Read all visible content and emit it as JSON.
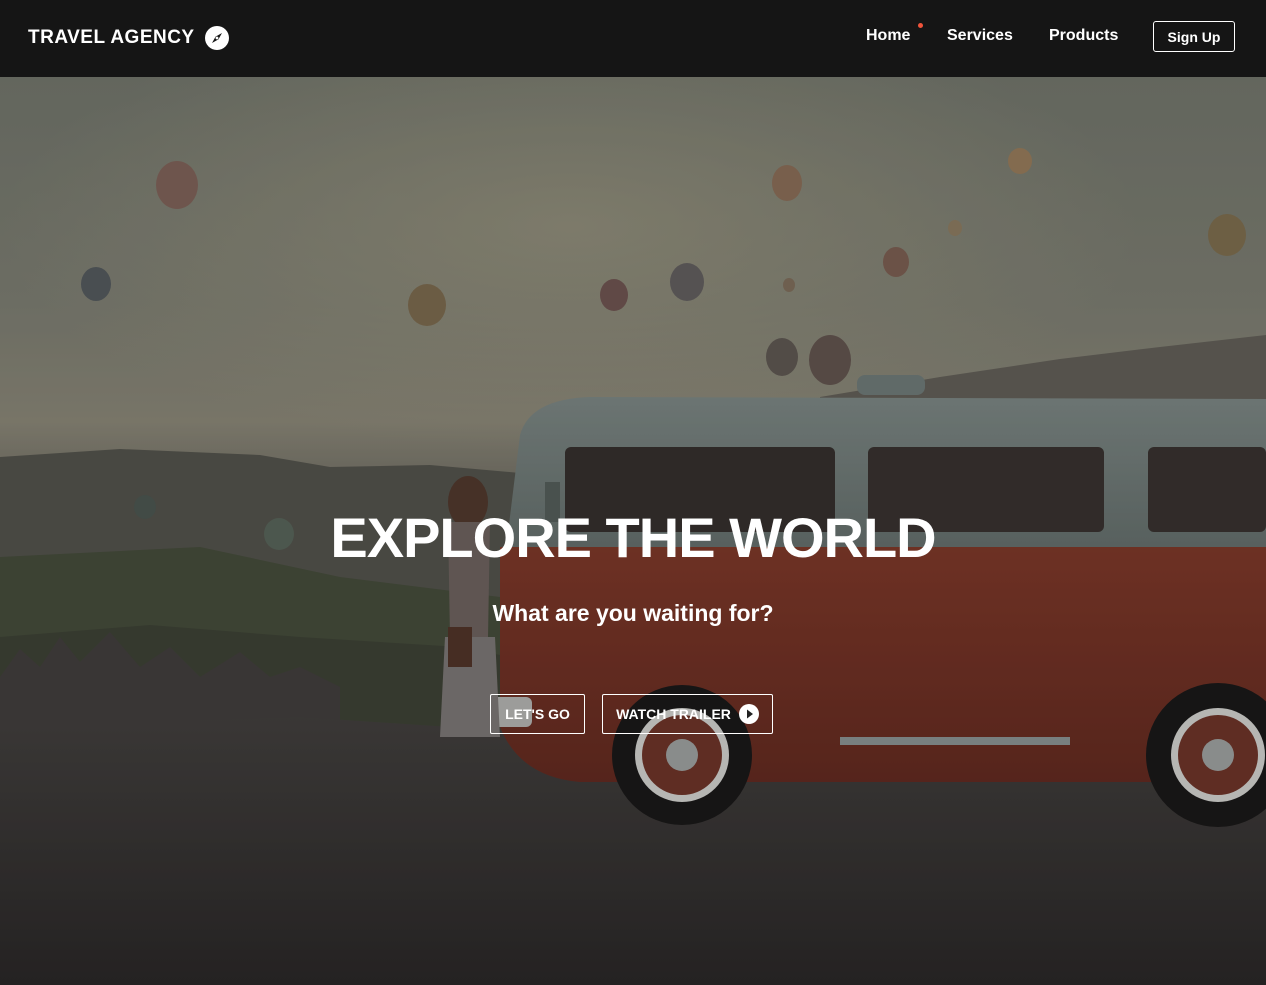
{
  "brand": {
    "name": "TRAVEL AGENCY",
    "icon": "compass-icon"
  },
  "nav": {
    "links": [
      {
        "label": "Home",
        "active": true
      },
      {
        "label": "Services",
        "active": false
      },
      {
        "label": "Products",
        "active": false
      }
    ],
    "signup_label": "Sign Up",
    "active_dot_color": "#f0533a"
  },
  "hero": {
    "title": "EXPLORE THE WORLD",
    "subtitle": "What are you waiting for?",
    "primary_button": "LET'S GO",
    "secondary_button": "WATCH TRAILER",
    "secondary_icon": "play-circle-icon"
  },
  "colors": {
    "navbar_bg": "#151515",
    "text": "#ffffff",
    "van_body": "#8a3f2e"
  }
}
